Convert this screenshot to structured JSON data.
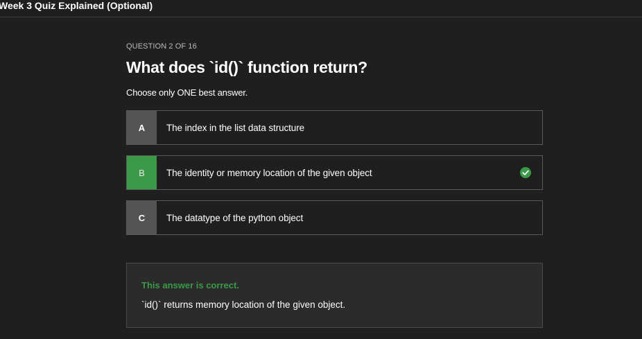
{
  "header": {
    "title": "Week 3 Quiz Explained (Optional)"
  },
  "question": {
    "counter": "QUESTION 2 OF 16",
    "title": "What does `id()` function return?",
    "instruction": "Choose only ONE best answer."
  },
  "options": [
    {
      "letter": "A",
      "text": "The index in the list data structure",
      "correct": false
    },
    {
      "letter": "B",
      "text": "The identity or memory location of the given object",
      "correct": true
    },
    {
      "letter": "C",
      "text": "The datatype of the python object",
      "correct": false
    }
  ],
  "feedback": {
    "status": "This answer is correct.",
    "explanation": "`id()` returns memory location of the given object."
  },
  "colors": {
    "background": "#1f1f1f",
    "correct_green": "#3a9a48",
    "letter_gray": "#545454",
    "feedback_bg": "#2b2b2b"
  },
  "icons": {
    "correct_indicator": "check-circle-icon"
  }
}
